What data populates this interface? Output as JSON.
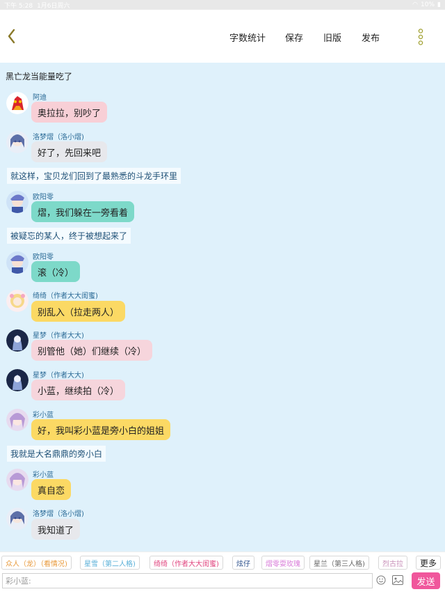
{
  "status": {
    "time": "下午 5:28",
    "date": "1月6日周六",
    "battery": "10%"
  },
  "toolbar": {
    "word_count": "字数统计",
    "save": "保存",
    "old_version": "旧版",
    "publish": "发布"
  },
  "chat": {
    "top_narration": "黑亡龙当能量吃了",
    "messages": [
      {
        "name": "阿迪",
        "text": "奥拉拉，别吵了"
      },
      {
        "name": "洛梦熠（洛小熠)",
        "text": "好了，先回来吧"
      },
      {
        "name": "欧阳零",
        "text": "熠，我们躲在一旁看着"
      },
      {
        "name": "欧阳零",
        "text": "滚（冷）"
      },
      {
        "name": "绮绮（作者大大闺蜜)",
        "text": "别乱入（拉走两人）"
      },
      {
        "name": "星梦（作者大大)",
        "text": "别管他（她）们继续（冷）"
      },
      {
        "name": "星梦（作者大大)",
        "text": "小蓝，继续拍（冷）"
      },
      {
        "name": "彩小蓝",
        "text": "好，我叫彩小蓝是旁小白的姐姐"
      },
      {
        "name": "彩小蓝",
        "text": "真自恋"
      },
      {
        "name": "洛梦熠（洛小熠)",
        "text": "我知道了"
      }
    ],
    "narrations": [
      "就这样，宝贝龙们回到了最熟悉的斗龙手环里",
      "被疑忘的某人，终于被想起来了",
      "我就是大名鼎鼎的旁小白"
    ]
  },
  "roles": [
    {
      "label": "众人（龙）（看情况)",
      "color": "#e89a3c"
    },
    {
      "label": "星雪（第二人格)",
      "color": "#5ab0d8"
    },
    {
      "label": "绮绮（作者大大闺蜜)",
      "color": "#e0457f"
    },
    {
      "label": "炫仔",
      "color": "#2a4e8a"
    },
    {
      "label": "熠零耍玫瑰",
      "color": "#d87ad8"
    },
    {
      "label": "星兰（第三人格)",
      "color": "#666666"
    },
    {
      "label": "烈古拉",
      "color": "#c78fb8"
    }
  ],
  "more_label": "更多",
  "input": {
    "placeholder": "彩小蓝:"
  },
  "send_label": "发送",
  "colors": {
    "accent": "#f0579c",
    "chat_bg": "#dff1fb",
    "back_arrow": "#8a7a2a",
    "menu_dots": "#a0a030"
  },
  "icons": [
    "back-arrow-icon",
    "more-menu-icon",
    "emoji-icon",
    "image-icon"
  ]
}
